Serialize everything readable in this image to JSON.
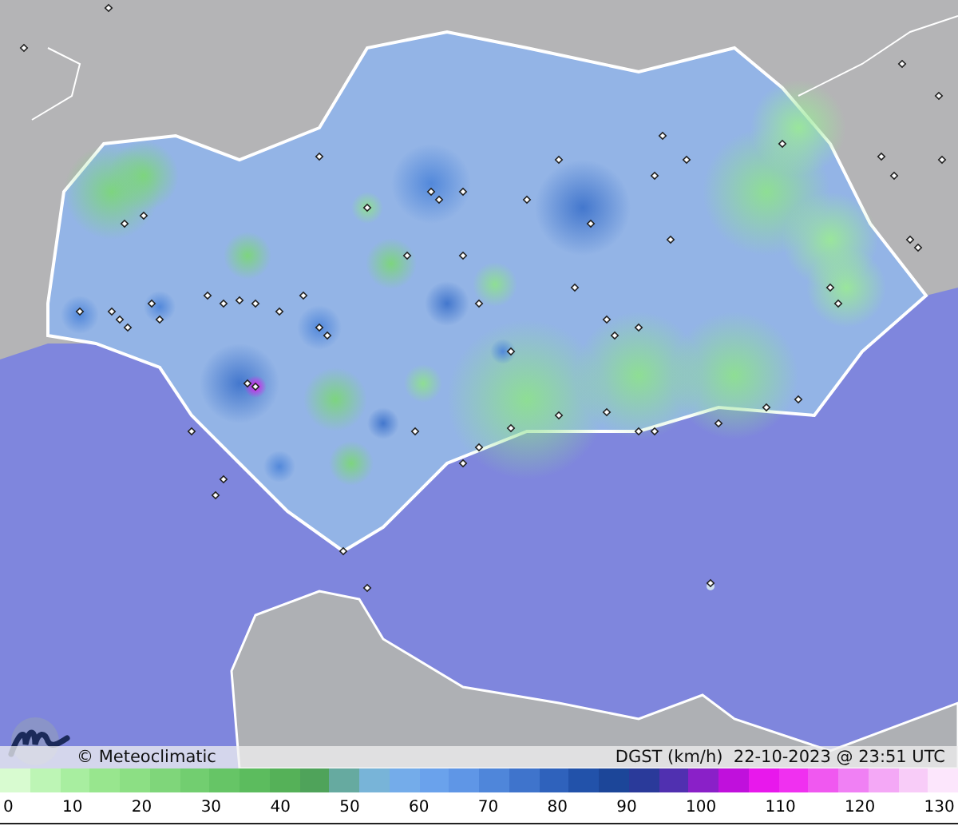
{
  "footer": {
    "copyright": "© Meteoclimatic",
    "caption": "DGST (km/h)  22-10-2023 @ 23:51 UTC"
  },
  "legend": {
    "ticks": [
      "0",
      "10",
      "20",
      "30",
      "40",
      "50",
      "60",
      "70",
      "80",
      "90",
      "100",
      "110",
      "120",
      "130"
    ]
  }
}
